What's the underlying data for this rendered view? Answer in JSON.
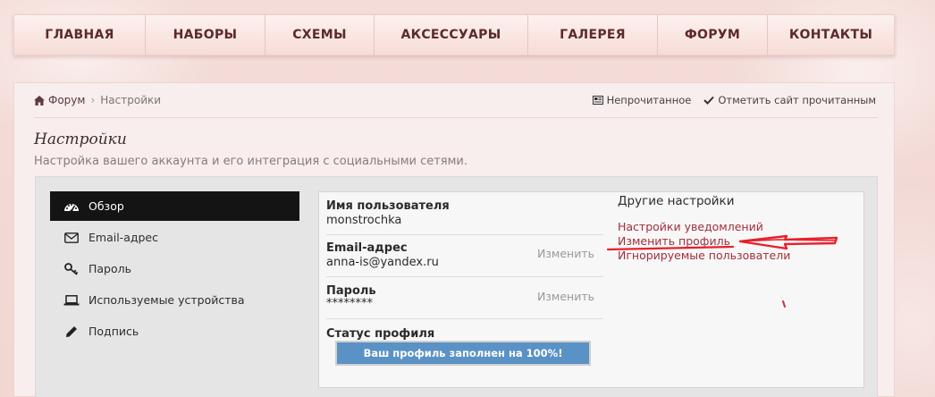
{
  "nav": {
    "items": [
      {
        "label": "ГЛАВНАЯ"
      },
      {
        "label": "НАБОРЫ"
      },
      {
        "label": "СХЕМЫ"
      },
      {
        "label": "АКСЕССУАРЫ"
      },
      {
        "label": "ГАЛЕРЕЯ"
      },
      {
        "label": "ФОРУМ"
      },
      {
        "label": "КОНТАКТЫ"
      }
    ]
  },
  "breadcrumb": {
    "forum": "Форум",
    "current": "Настройки"
  },
  "top_links": {
    "unread": "Непрочитанное",
    "mark_read": "Отметить сайт прочитанным"
  },
  "page": {
    "title": "Настройки",
    "description": "Настройка вашего аккаунта и его интеграция с социальными сетями."
  },
  "side_menu": {
    "items": [
      {
        "label": "Обзор",
        "icon": "dashboard-icon",
        "active": true
      },
      {
        "label": "Email-адрес",
        "icon": "envelope-icon"
      },
      {
        "label": "Пароль",
        "icon": "key-icon"
      },
      {
        "label": "Используемые устройства",
        "icon": "laptop-icon"
      },
      {
        "label": "Подпись",
        "icon": "pencil-icon"
      }
    ]
  },
  "account": {
    "username_label": "Имя пользователя",
    "username_value": "monstrochka",
    "email_label": "Email-адрес",
    "email_value": "anna-is@yandex.ru",
    "password_label": "Пароль",
    "password_value": "********",
    "change_label": "Изменить",
    "status_label": "Статус профиля",
    "status_text": "Ваш профиль заполнен на 100%!",
    "profile_completion_percent": 100
  },
  "other_settings": {
    "title": "Другие настройки",
    "links": [
      {
        "label": "Настройки уведомлений"
      },
      {
        "label": "Изменить профиль"
      },
      {
        "label": "Игнорируемые пользователи"
      }
    ]
  },
  "colors": {
    "accent_red": "#a12f3a",
    "progress_blue": "#5b92c5",
    "annotation_red": "#e8202a"
  }
}
